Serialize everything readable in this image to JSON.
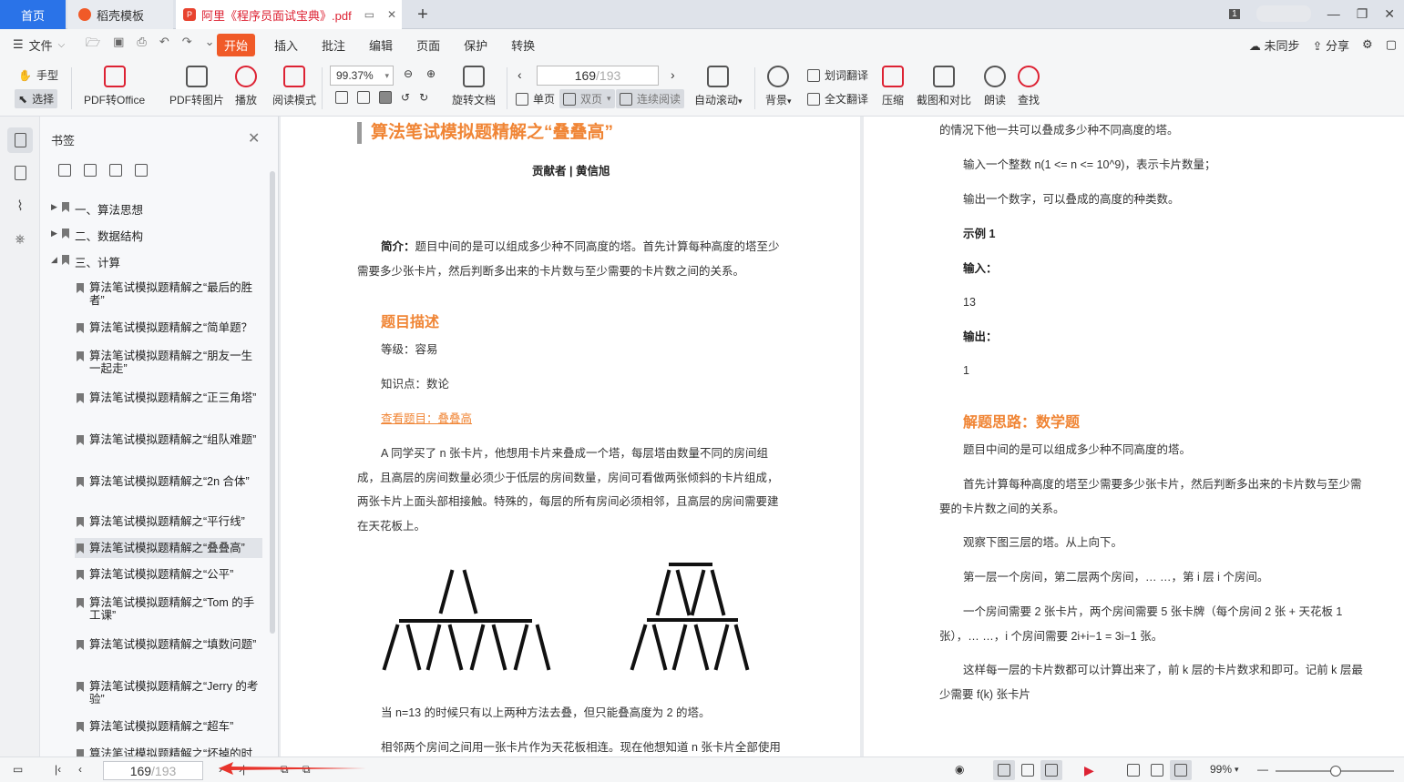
{
  "tabs": {
    "home": "首页",
    "template": "稻壳模板",
    "doc_prefix": "阿里",
    "doc_title": "《程序员面试宝典》.pdf",
    "page_count_badge": "1"
  },
  "menu": {
    "file": "文件",
    "items": [
      "开始",
      "插入",
      "批注",
      "编辑",
      "页面",
      "保护",
      "转换"
    ],
    "sync": "未同步",
    "share": "分享"
  },
  "ribbon": {
    "hand": "手型",
    "select": "选择",
    "pdf_to_office": "PDF转Office",
    "pdf_to_image": "PDF转图片",
    "play": "播放",
    "reading_mode": "阅读模式",
    "zoom": "99.37%",
    "rotate": "旋转文档",
    "page_current": "169",
    "page_total": "/193",
    "single": "单页",
    "double": "双页",
    "continuous": "连续阅读",
    "autoscroll": "自动滚动",
    "background": "背景",
    "word_translate": "划词翻译",
    "full_translate": "全文翻译",
    "compress": "压缩",
    "screenshot_compare": "截图和对比",
    "read_aloud": "朗读",
    "find": "查找"
  },
  "bookmarks": {
    "title": "书签",
    "top": [
      "一、算法思想",
      "二、数据结构",
      "三、计算"
    ],
    "children": [
      "算法笔试模拟题精解之“最后的胜者”",
      "算法笔试模拟题精解之“简单题？",
      "算法笔试模拟题精解之“朋友一生一起走”",
      "算法笔试模拟题精解之“正三角塔”",
      "算法笔试模拟题精解之“组队难题”",
      "算法笔试模拟题精解之“2n 合体”",
      "算法笔试模拟题精解之“平行线”",
      "算法笔试模拟题精解之“叠叠高”",
      "算法笔试模拟题精解之“公平”",
      "算法笔试模拟题精解之“Tom 的手工课”",
      "算法笔试模拟题精解之“填数问题”",
      "算法笔试模拟题精解之“Jerry 的考验”",
      "算法笔试模拟题精解之“超车”",
      "算法笔试模拟题精解之“坏掉的时"
    ]
  },
  "left_page": {
    "heading": "算法笔试模拟题精解之“叠叠高”",
    "contributor": "贡献者 | 黄信旭",
    "intro_label": "简介：",
    "intro_line1": "题目中间的是可以组成多少种不同高度的塔。首先计算每种高度的塔至少",
    "intro_line2": "需要多少张卡片，然后判断多出来的卡片数与至少需要的卡片数之间的关系。",
    "section_title": "题目描述",
    "level": "等级：容易",
    "knowledge": "知识点：数论",
    "link": "查看题目：叠叠高",
    "p1": "A 同学买了 n 张卡片，他想用卡片来叠成一个塔，每层塔由数量不同的房间组",
    "p2": "成，且高层的房间数量必须少于低层的房间数量，房间可看做两张倾斜的卡片组成，",
    "p3": "两张卡片上面头部相接触。特殊的，每层的所有房间必须相邻，且高层的房间需要建",
    "p4": "在天花板上。",
    "p5": "当 n=13 的时候只有以上两种方法去叠，但只能叠高度为 2 的塔。",
    "p6": "相邻两个房间之间用一张卡片作为天花板相连。现在他想知道 n 张卡片全部使用"
  },
  "right_page": {
    "l0": "的情况下他一共可以叠成多少种不同高度的塔。",
    "l1": "输入一个整数 n(1 <= n <= 10^9)，表示卡片数量；",
    "l2": "输出一个数字，可以叠成的高度的种类数。",
    "example": "示例 1",
    "input_label": "输入：",
    "input_val": "13",
    "output_label": "输出：",
    "output_val": "1",
    "solution_title": "解题思路：数学题",
    "s1": "题目中间的是可以组成多少种不同高度的塔。",
    "s2a": "首先计算每种高度的塔至少需要多少张卡片，然后判断多出来的卡片数与至少需",
    "s2b": "要的卡片数之间的关系。",
    "s3": "观察下图三层的塔。从上向下。",
    "s4": "第一层一个房间，第二层两个房间，… …，第 i 层 i 个房间。",
    "s5a": "一个房间需要 2 张卡片，两个房间需要 5 张卡牌（每个房间 2 张 + 天花板 1",
    "s5b": "张），… …，i 个房间需要 2i+i−1 = 3i−1 张。",
    "s6a": "这样每一层的卡片数都可以计算出来了，前 k 层的卡片数求和即可。记前 k 层最",
    "s6b": "少需要 f(k) 张卡片"
  },
  "status": {
    "page_current": "169",
    "page_total": "/193",
    "zoom": "99%"
  },
  "colors": {
    "accent_orange": "#f08535",
    "start_tab": "#f05a28",
    "home_tab": "#2a73e8",
    "annotation_arrow": "#e8342c"
  }
}
